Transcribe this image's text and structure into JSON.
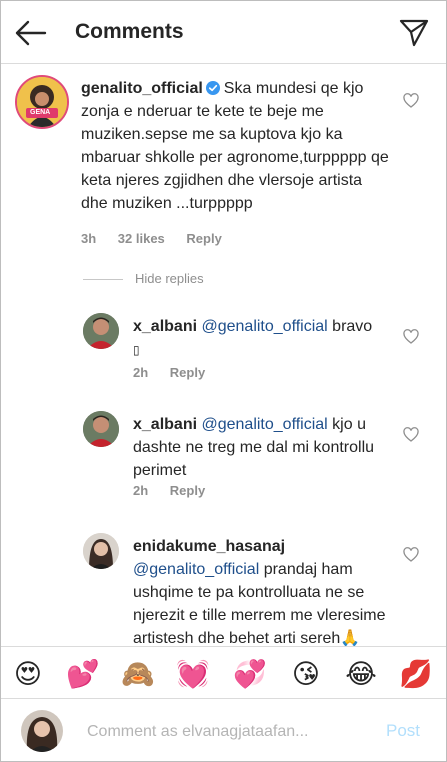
{
  "header": {
    "title": "Comments",
    "back_icon": "arrow-left-icon",
    "send_icon": "paper-plane-icon"
  },
  "comments": [
    {
      "username": "genalito_official",
      "verified": true,
      "avatar_label": "GENA",
      "text": "Ska mundesi qe kjo zonja e nderuar te kete te beje me muziken.sepse me sa kuptova kjo ka mbaruar shkolle per agronome,turppppp qe keta njeres zgjidhen dhe vlersoje artista dhe muziken ...turppppp",
      "time": "3h",
      "likes": "32 likes",
      "reply": "Reply"
    }
  ],
  "hide_replies": "Hide replies",
  "replies": [
    {
      "username": "x_albani",
      "mention": "@genalito_official",
      "text": " bravo",
      "glyph": "▯",
      "time": "2h",
      "reply": "Reply"
    },
    {
      "username": "x_albani",
      "mention": "@genalito_official",
      "text": "  kjo u dashte ne treg me dal mi kontrollu perimet",
      "time": "2h",
      "reply": "Reply"
    },
    {
      "username": "enidakume_hasanaj",
      "mention": "@genalito_official",
      "text": " prandaj ham ushqime te pa kontrolluata ne se njerezit e tille merrem me vleresime artistesh dhe behet arti sereh🙏"
    }
  ],
  "emojis": [
    "😍",
    "💕",
    "🙈",
    "💓",
    "💞",
    "😘",
    "😂",
    "💋"
  ],
  "input": {
    "placeholder": "Comment as elvanagjataafan...",
    "post_label": "Post"
  },
  "colors": {
    "mention": "#1f4f8b",
    "post": "#b2dffc",
    "verified": "#3897f0"
  }
}
